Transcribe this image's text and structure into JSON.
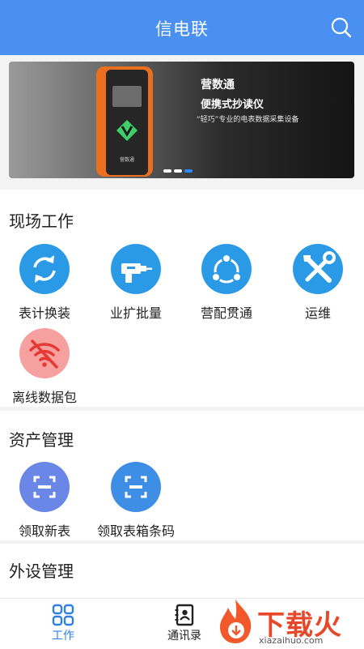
{
  "header": {
    "title": "信电联",
    "search_icon": "search-icon"
  },
  "banner": {
    "title": "营数通",
    "subtitle": "便携式抄读仪",
    "description": "“轻巧”专业的电表数据采集设备",
    "device_brand": "营数通",
    "page_count": 3,
    "active_page": 3
  },
  "sections": {
    "field_work": {
      "title": "现场工作",
      "items": [
        {
          "label": "表计换装",
          "icon": "refresh-icon",
          "color": "#2a9ae6"
        },
        {
          "label": "业扩批量",
          "icon": "drill-icon",
          "color": "#2a9ae6"
        },
        {
          "label": "营配贯通",
          "icon": "share-icon",
          "color": "#2a9ae6"
        },
        {
          "label": "运维",
          "icon": "tools-icon",
          "color": "#2a9ae6"
        },
        {
          "label": "离线数据包",
          "icon": "wifi-off-icon",
          "color": "#f7a0a0"
        }
      ]
    },
    "asset_management": {
      "title": "资产管理",
      "items": [
        {
          "label": "领取新表",
          "icon": "scan-icon",
          "color": "#6a86e6"
        },
        {
          "label": "领取表箱条码",
          "icon": "scan-icon",
          "color": "#3f8ee6"
        }
      ]
    },
    "peripheral_management": {
      "title": "外设管理"
    }
  },
  "tabbar": {
    "tabs": [
      {
        "label": "工作",
        "icon": "grid-icon",
        "active": true
      },
      {
        "label": "通讯录",
        "icon": "contacts-icon",
        "active": false
      }
    ],
    "active_color": "#2f7fe6"
  },
  "watermark": {
    "text": "下载火",
    "url": "xiazaihuo.com"
  }
}
